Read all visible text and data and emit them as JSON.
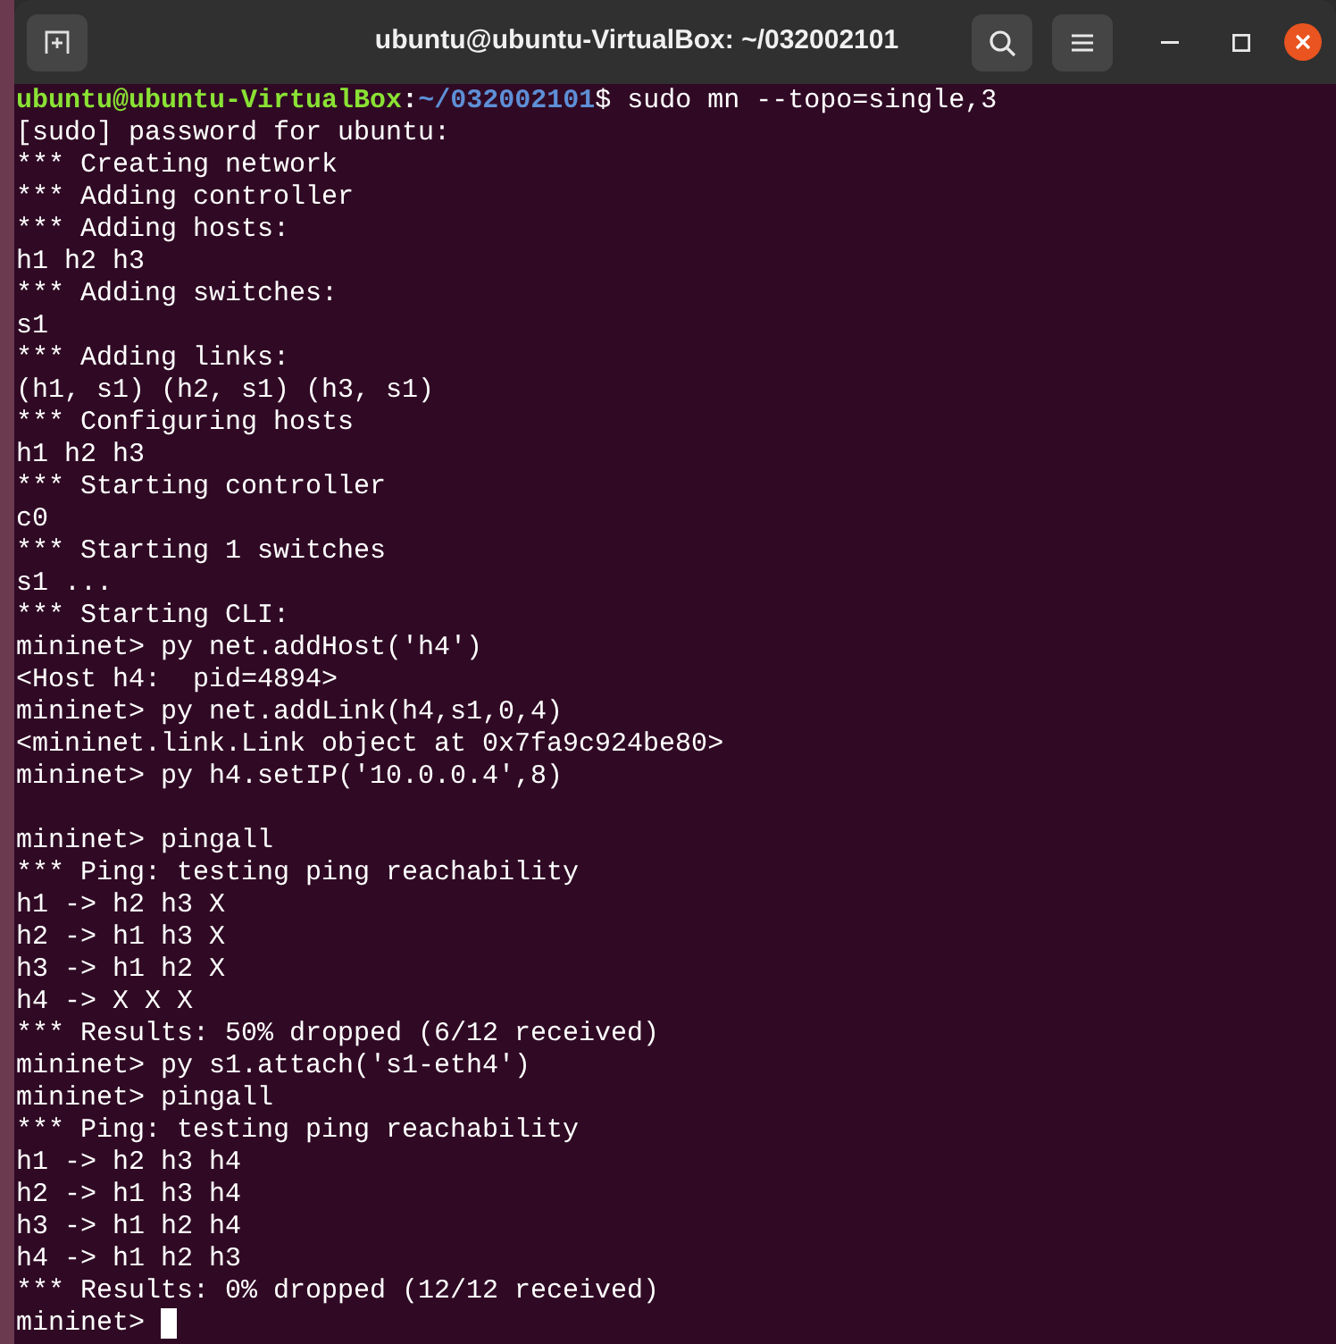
{
  "window": {
    "title": "ubuntu@ubuntu-VirtualBox: ~/032002101"
  },
  "terminal": {
    "lines": [
      {
        "kind": "prompt",
        "user_host": "ubuntu@ubuntu-VirtualBox",
        "separator": ":",
        "path": "~/032002101",
        "command": "$ sudo mn --topo=single,3"
      },
      {
        "kind": "output",
        "text": "[sudo] password for ubuntu:"
      },
      {
        "kind": "output",
        "text": "*** Creating network"
      },
      {
        "kind": "output",
        "text": "*** Adding controller"
      },
      {
        "kind": "output",
        "text": "*** Adding hosts:"
      },
      {
        "kind": "output",
        "text": "h1 h2 h3"
      },
      {
        "kind": "output",
        "text": "*** Adding switches:"
      },
      {
        "kind": "output",
        "text": "s1"
      },
      {
        "kind": "output",
        "text": "*** Adding links:"
      },
      {
        "kind": "output",
        "text": "(h1, s1) (h2, s1) (h3, s1)"
      },
      {
        "kind": "output",
        "text": "*** Configuring hosts"
      },
      {
        "kind": "output",
        "text": "h1 h2 h3"
      },
      {
        "kind": "output",
        "text": "*** Starting controller"
      },
      {
        "kind": "output",
        "text": "c0"
      },
      {
        "kind": "output",
        "text": "*** Starting 1 switches"
      },
      {
        "kind": "output",
        "text": "s1 ..."
      },
      {
        "kind": "output",
        "text": "*** Starting CLI:"
      },
      {
        "kind": "output",
        "text": "mininet> py net.addHost('h4')"
      },
      {
        "kind": "output",
        "text": "<Host h4:  pid=4894>"
      },
      {
        "kind": "output",
        "text": "mininet> py net.addLink(h4,s1,0,4)"
      },
      {
        "kind": "output",
        "text": "<mininet.link.Link object at 0x7fa9c924be80>"
      },
      {
        "kind": "output",
        "text": "mininet> py h4.setIP('10.0.0.4',8)"
      },
      {
        "kind": "blank"
      },
      {
        "kind": "output",
        "text": "mininet> pingall"
      },
      {
        "kind": "output",
        "text": "*** Ping: testing ping reachability"
      },
      {
        "kind": "output",
        "text": "h1 -> h2 h3 X"
      },
      {
        "kind": "output",
        "text": "h2 -> h1 h3 X"
      },
      {
        "kind": "output",
        "text": "h3 -> h1 h2 X"
      },
      {
        "kind": "output",
        "text": "h4 -> X X X"
      },
      {
        "kind": "output",
        "text": "*** Results: 50% dropped (6/12 received)"
      },
      {
        "kind": "output",
        "text": "mininet> py s1.attach('s1-eth4')"
      },
      {
        "kind": "output",
        "text": "mininet> pingall"
      },
      {
        "kind": "output",
        "text": "*** Ping: testing ping reachability"
      },
      {
        "kind": "output",
        "text": "h1 -> h2 h3 h4"
      },
      {
        "kind": "output",
        "text": "h2 -> h1 h3 h4"
      },
      {
        "kind": "output",
        "text": "h3 -> h1 h2 h4"
      },
      {
        "kind": "output",
        "text": "h4 -> h1 h2 h3"
      },
      {
        "kind": "output",
        "text": "*** Results: 0% dropped (12/12 received)"
      },
      {
        "kind": "input",
        "text": "mininet> ",
        "cursor": true
      }
    ]
  }
}
